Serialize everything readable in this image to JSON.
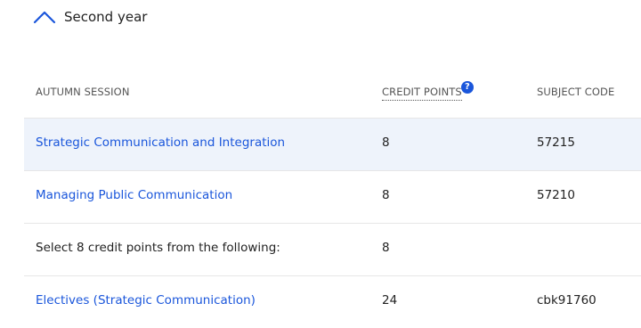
{
  "section": {
    "title": "Second year"
  },
  "table": {
    "headers": {
      "session": "AUTUMN SESSION",
      "credit_points": "CREDIT POINTS",
      "subject_code": "SUBJECT CODE"
    },
    "help_glyph": "?",
    "rows": [
      {
        "name": "Strategic Communication and Integration",
        "credit": "8",
        "code": "57215"
      },
      {
        "name": "Managing Public Communication",
        "credit": "8",
        "code": "57210"
      },
      {
        "name": "Select 8 credit points from the following:",
        "credit": "8",
        "code": ""
      },
      {
        "name": "Electives (Strategic Communication)",
        "credit": "24",
        "code": "cbk91760"
      }
    ]
  },
  "colors": {
    "link": "#1a56db",
    "row_highlight": "#eef3fb",
    "divider": "#e6e6e6"
  }
}
